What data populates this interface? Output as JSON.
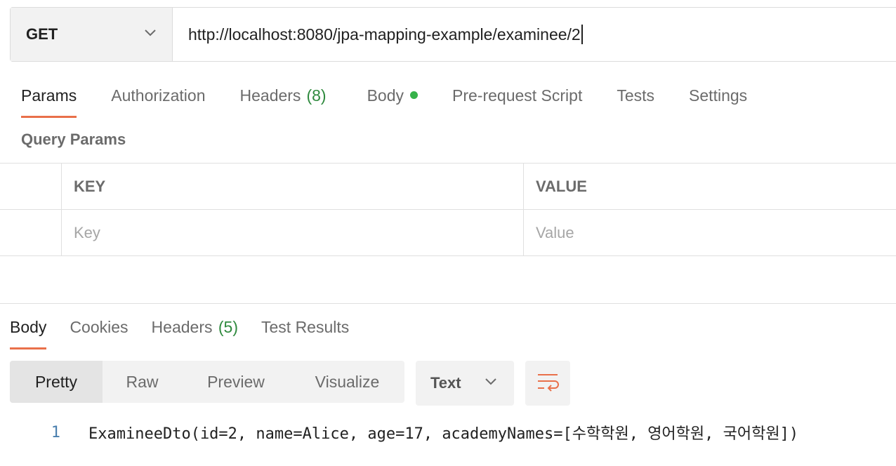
{
  "request": {
    "method": "GET",
    "url": "http://localhost:8080/jpa-mapping-example/examinee/2"
  },
  "request_tabs": {
    "params": "Params",
    "authorization": "Authorization",
    "headers": "Headers",
    "headers_count": "(8)",
    "body": "Body",
    "prerequest": "Pre-request Script",
    "tests": "Tests",
    "settings": "Settings"
  },
  "query_params": {
    "title": "Query Params",
    "key_header": "KEY",
    "value_header": "VALUE",
    "key_placeholder": "Key",
    "value_placeholder": "Value"
  },
  "response_tabs": {
    "body": "Body",
    "cookies": "Cookies",
    "headers": "Headers",
    "headers_count": "(5)",
    "test_results": "Test Results"
  },
  "views": {
    "pretty": "Pretty",
    "raw": "Raw",
    "preview": "Preview",
    "visualize": "Visualize"
  },
  "format": "Text",
  "response_body": [
    {
      "line": "1",
      "text": "ExamineeDto(id=2, name=Alice, age=17, academyNames=[수학학원, 영어학원, 국어학원])"
    }
  ],
  "colors": {
    "accent": "#e9704a",
    "count_green": "#2f8a3e",
    "dot_green": "#36b24a"
  }
}
